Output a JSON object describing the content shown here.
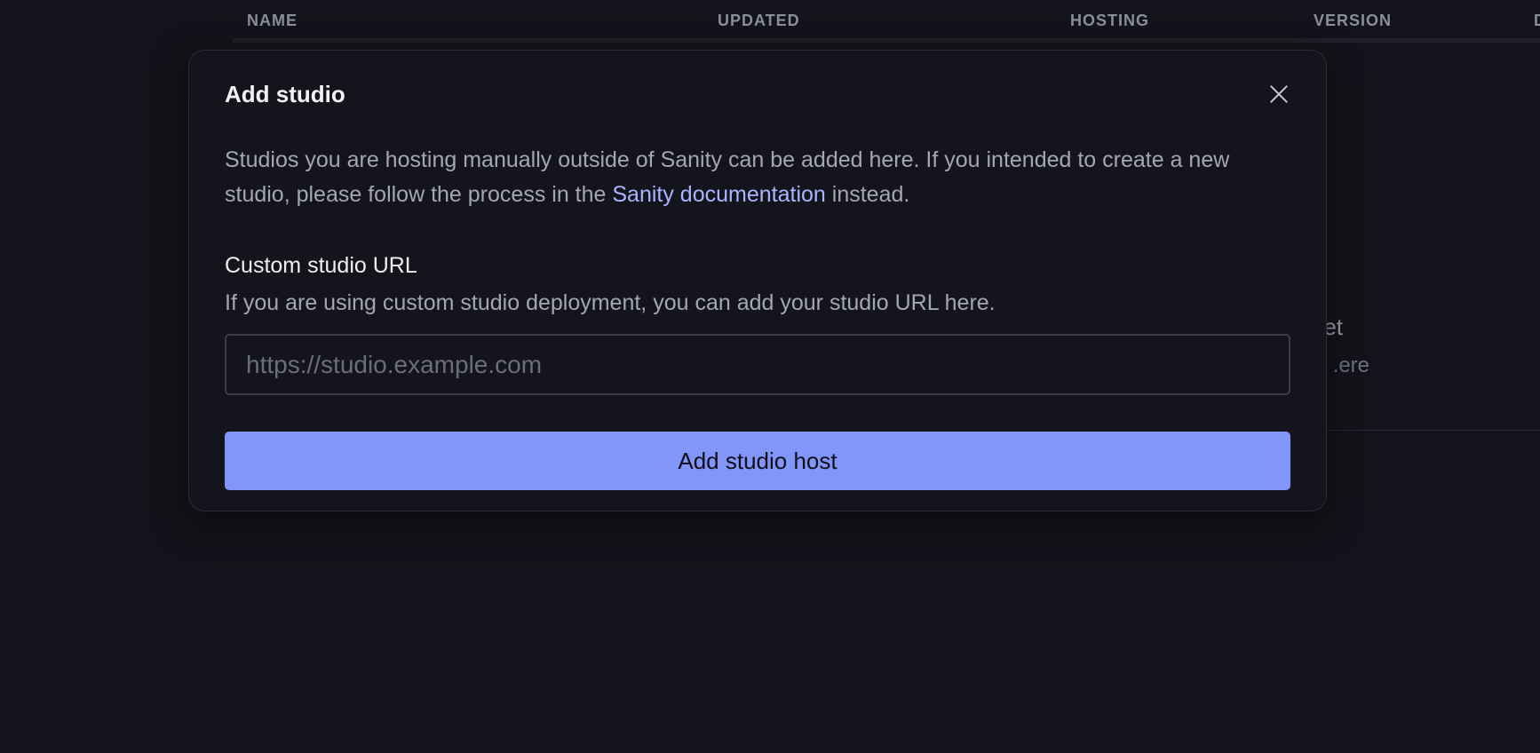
{
  "table": {
    "columns": [
      "NAME",
      "UPDATED",
      "HOSTING",
      "VERSION",
      "D"
    ],
    "empty_state": {
      "line1_fragment": "et.",
      "line2_fragment": "ere."
    }
  },
  "modal": {
    "title": "Add studio",
    "intro_before_link": "Studios you are hosting manually outside of Sanity can be added here. If you intended to create a new studio, please follow the process in the ",
    "intro_link": "Sanity documentation",
    "intro_after_link": " instead.",
    "field_label": "Custom studio URL",
    "field_description": "If you are using custom studio deployment, you can add your studio URL here.",
    "url_input": {
      "value": "",
      "placeholder": "https://studio.example.com"
    },
    "submit_label": "Add studio host",
    "close_icon": "close-icon"
  },
  "colors": {
    "background": "#13141b",
    "accent": "#8196f8",
    "link": "#aab4ff"
  }
}
